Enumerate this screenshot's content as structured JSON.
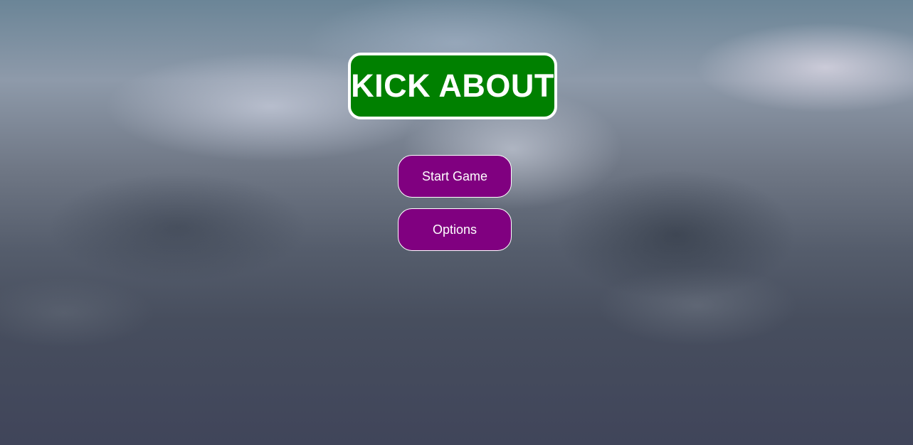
{
  "title": "KICK ABOUT",
  "menu": {
    "start_label": "Start Game",
    "options_label": "Options"
  },
  "colors": {
    "title_background": "#008000",
    "button_background": "#800080",
    "text": "#ffffff",
    "border": "#ffffff"
  }
}
